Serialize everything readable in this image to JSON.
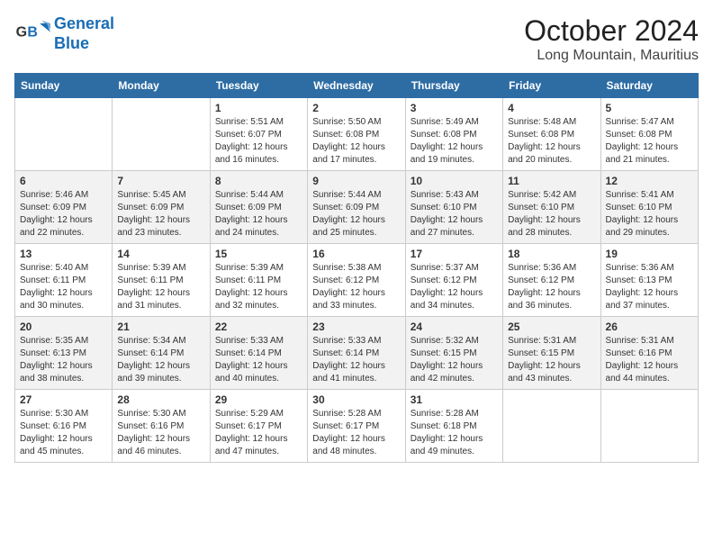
{
  "header": {
    "logo_line1": "General",
    "logo_line2": "Blue",
    "month_year": "October 2024",
    "location": "Long Mountain, Mauritius"
  },
  "days_of_week": [
    "Sunday",
    "Monday",
    "Tuesday",
    "Wednesday",
    "Thursday",
    "Friday",
    "Saturday"
  ],
  "weeks": [
    [
      {
        "day": "",
        "info": ""
      },
      {
        "day": "",
        "info": ""
      },
      {
        "day": "1",
        "info": "Sunrise: 5:51 AM\nSunset: 6:07 PM\nDaylight: 12 hours and 16 minutes."
      },
      {
        "day": "2",
        "info": "Sunrise: 5:50 AM\nSunset: 6:08 PM\nDaylight: 12 hours and 17 minutes."
      },
      {
        "day": "3",
        "info": "Sunrise: 5:49 AM\nSunset: 6:08 PM\nDaylight: 12 hours and 19 minutes."
      },
      {
        "day": "4",
        "info": "Sunrise: 5:48 AM\nSunset: 6:08 PM\nDaylight: 12 hours and 20 minutes."
      },
      {
        "day": "5",
        "info": "Sunrise: 5:47 AM\nSunset: 6:08 PM\nDaylight: 12 hours and 21 minutes."
      }
    ],
    [
      {
        "day": "6",
        "info": "Sunrise: 5:46 AM\nSunset: 6:09 PM\nDaylight: 12 hours and 22 minutes."
      },
      {
        "day": "7",
        "info": "Sunrise: 5:45 AM\nSunset: 6:09 PM\nDaylight: 12 hours and 23 minutes."
      },
      {
        "day": "8",
        "info": "Sunrise: 5:44 AM\nSunset: 6:09 PM\nDaylight: 12 hours and 24 minutes."
      },
      {
        "day": "9",
        "info": "Sunrise: 5:44 AM\nSunset: 6:09 PM\nDaylight: 12 hours and 25 minutes."
      },
      {
        "day": "10",
        "info": "Sunrise: 5:43 AM\nSunset: 6:10 PM\nDaylight: 12 hours and 27 minutes."
      },
      {
        "day": "11",
        "info": "Sunrise: 5:42 AM\nSunset: 6:10 PM\nDaylight: 12 hours and 28 minutes."
      },
      {
        "day": "12",
        "info": "Sunrise: 5:41 AM\nSunset: 6:10 PM\nDaylight: 12 hours and 29 minutes."
      }
    ],
    [
      {
        "day": "13",
        "info": "Sunrise: 5:40 AM\nSunset: 6:11 PM\nDaylight: 12 hours and 30 minutes."
      },
      {
        "day": "14",
        "info": "Sunrise: 5:39 AM\nSunset: 6:11 PM\nDaylight: 12 hours and 31 minutes."
      },
      {
        "day": "15",
        "info": "Sunrise: 5:39 AM\nSunset: 6:11 PM\nDaylight: 12 hours and 32 minutes."
      },
      {
        "day": "16",
        "info": "Sunrise: 5:38 AM\nSunset: 6:12 PM\nDaylight: 12 hours and 33 minutes."
      },
      {
        "day": "17",
        "info": "Sunrise: 5:37 AM\nSunset: 6:12 PM\nDaylight: 12 hours and 34 minutes."
      },
      {
        "day": "18",
        "info": "Sunrise: 5:36 AM\nSunset: 6:12 PM\nDaylight: 12 hours and 36 minutes."
      },
      {
        "day": "19",
        "info": "Sunrise: 5:36 AM\nSunset: 6:13 PM\nDaylight: 12 hours and 37 minutes."
      }
    ],
    [
      {
        "day": "20",
        "info": "Sunrise: 5:35 AM\nSunset: 6:13 PM\nDaylight: 12 hours and 38 minutes."
      },
      {
        "day": "21",
        "info": "Sunrise: 5:34 AM\nSunset: 6:14 PM\nDaylight: 12 hours and 39 minutes."
      },
      {
        "day": "22",
        "info": "Sunrise: 5:33 AM\nSunset: 6:14 PM\nDaylight: 12 hours and 40 minutes."
      },
      {
        "day": "23",
        "info": "Sunrise: 5:33 AM\nSunset: 6:14 PM\nDaylight: 12 hours and 41 minutes."
      },
      {
        "day": "24",
        "info": "Sunrise: 5:32 AM\nSunset: 6:15 PM\nDaylight: 12 hours and 42 minutes."
      },
      {
        "day": "25",
        "info": "Sunrise: 5:31 AM\nSunset: 6:15 PM\nDaylight: 12 hours and 43 minutes."
      },
      {
        "day": "26",
        "info": "Sunrise: 5:31 AM\nSunset: 6:16 PM\nDaylight: 12 hours and 44 minutes."
      }
    ],
    [
      {
        "day": "27",
        "info": "Sunrise: 5:30 AM\nSunset: 6:16 PM\nDaylight: 12 hours and 45 minutes."
      },
      {
        "day": "28",
        "info": "Sunrise: 5:30 AM\nSunset: 6:16 PM\nDaylight: 12 hours and 46 minutes."
      },
      {
        "day": "29",
        "info": "Sunrise: 5:29 AM\nSunset: 6:17 PM\nDaylight: 12 hours and 47 minutes."
      },
      {
        "day": "30",
        "info": "Sunrise: 5:28 AM\nSunset: 6:17 PM\nDaylight: 12 hours and 48 minutes."
      },
      {
        "day": "31",
        "info": "Sunrise: 5:28 AM\nSunset: 6:18 PM\nDaylight: 12 hours and 49 minutes."
      },
      {
        "day": "",
        "info": ""
      },
      {
        "day": "",
        "info": ""
      }
    ]
  ]
}
